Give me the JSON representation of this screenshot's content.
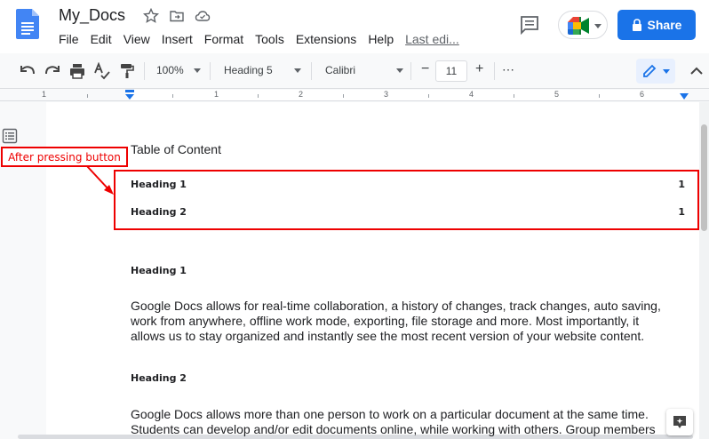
{
  "title_bar": {
    "doc_title": "My_Docs",
    "share_label": "Share",
    "brand_color": "#1a73e8"
  },
  "menu": {
    "items": [
      "File",
      "Edit",
      "View",
      "Insert",
      "Format",
      "Tools",
      "Extensions",
      "Help"
    ],
    "last_edit": "Last edi..."
  },
  "toolbar": {
    "zoom": "100%",
    "style": "Heading 5",
    "font": "Calibri",
    "font_size": "11",
    "minus": "−",
    "plus": "+",
    "more": "⋯"
  },
  "ruler": {
    "numbers": [
      "1",
      "1",
      "2",
      "3",
      "4",
      "5",
      "6"
    ]
  },
  "annotation": {
    "callout_text": "After pressing button",
    "color": "#ee0000"
  },
  "document": {
    "toc_title": "Table of Content",
    "toc": [
      {
        "label": "Heading 1",
        "page": "1"
      },
      {
        "label": "Heading 2",
        "page": "1"
      }
    ],
    "heading1": "Heading 1",
    "para1": "Google Docs allows for real-time collaboration, a history of changes, track changes, auto saving, work from anywhere, offline work mode, exporting, file storage and more. Most importantly, it allows us to stay organized and instantly see the most recent version of your website content.",
    "heading2": "Heading 2",
    "para2_line1": "Google Docs allows more than one person to work on a particular document at the same time.",
    "para2_line2": "Students can develop and/or edit documents online, while working with others. Group members"
  }
}
